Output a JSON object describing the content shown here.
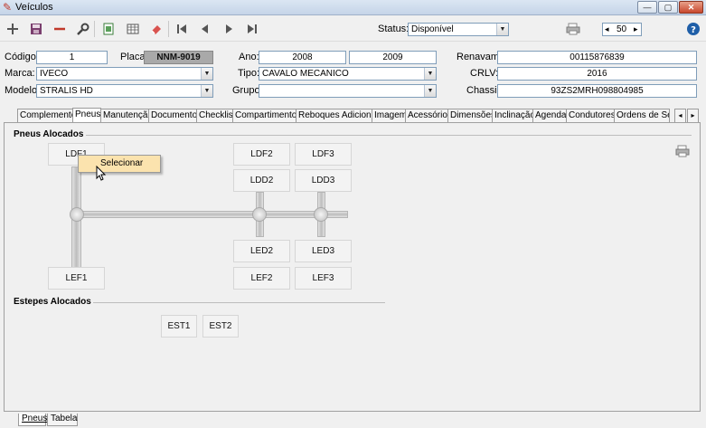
{
  "window": {
    "title": "Veículos",
    "controls": {
      "min": "—",
      "max": "▢",
      "close": "✕"
    }
  },
  "toolbar": {
    "icons": [
      "add-icon",
      "save-icon",
      "remove-icon",
      "search-icon",
      "export-icon",
      "grid-icon",
      "eraser-icon",
      "first-icon",
      "prev-icon",
      "next-icon",
      "last-icon"
    ],
    "status_label": "Status:",
    "status_value": "Disponível",
    "page_size": "50",
    "page_prev": "◂",
    "page_next": "▸"
  },
  "form": {
    "codigo_label": "Código:",
    "codigo": "1",
    "placa_label": "Placa:",
    "placa": "NNM-9019",
    "ano_label": "Ano:",
    "ano_fab": "2008",
    "ano_mod": "2009",
    "renavam_label": "Renavam:",
    "renavam": "00115876839",
    "marca_label": "Marca:",
    "marca": "IVECO",
    "tipo_label": "Tipo:",
    "tipo": "CAVALO MECANICO",
    "crlv_label": "CRLV:",
    "crlv": "2016",
    "modelo_label": "Modelo:",
    "modelo": "STRALIS HD",
    "grupo_label": "Grupo:",
    "grupo": "",
    "chassi_label": "Chassi:",
    "chassi": "93ZS2MRH098804985"
  },
  "tabs": [
    "Complemento",
    "Pneus",
    "Manutenção",
    "Documentos",
    "Checklist",
    "Compartimentos",
    "Reboques Adicionais",
    "Imagem",
    "Acessórios",
    "Dimensões",
    "Inclinação",
    "Agenda",
    "Condutores",
    "Ordens de Serv"
  ],
  "pneus": {
    "section_title": "Pneus Alocados",
    "slots": {
      "ldf1": "LDF1",
      "lef1": "LEF1",
      "ldf2": "LDF2",
      "ldd2": "LDD2",
      "led2": "LED2",
      "lef2": "LEF2",
      "ldf3": "LDF3",
      "ldd3": "LDD3",
      "led3": "LED3",
      "lef3": "LEF3"
    },
    "estepes_title": "Estepes Alocados",
    "estepes": {
      "est1": "EST1",
      "est2": "EST2"
    }
  },
  "context_menu": {
    "item": "Selecionar"
  },
  "bottom_tabs": [
    "Pneus",
    "Tabela"
  ]
}
